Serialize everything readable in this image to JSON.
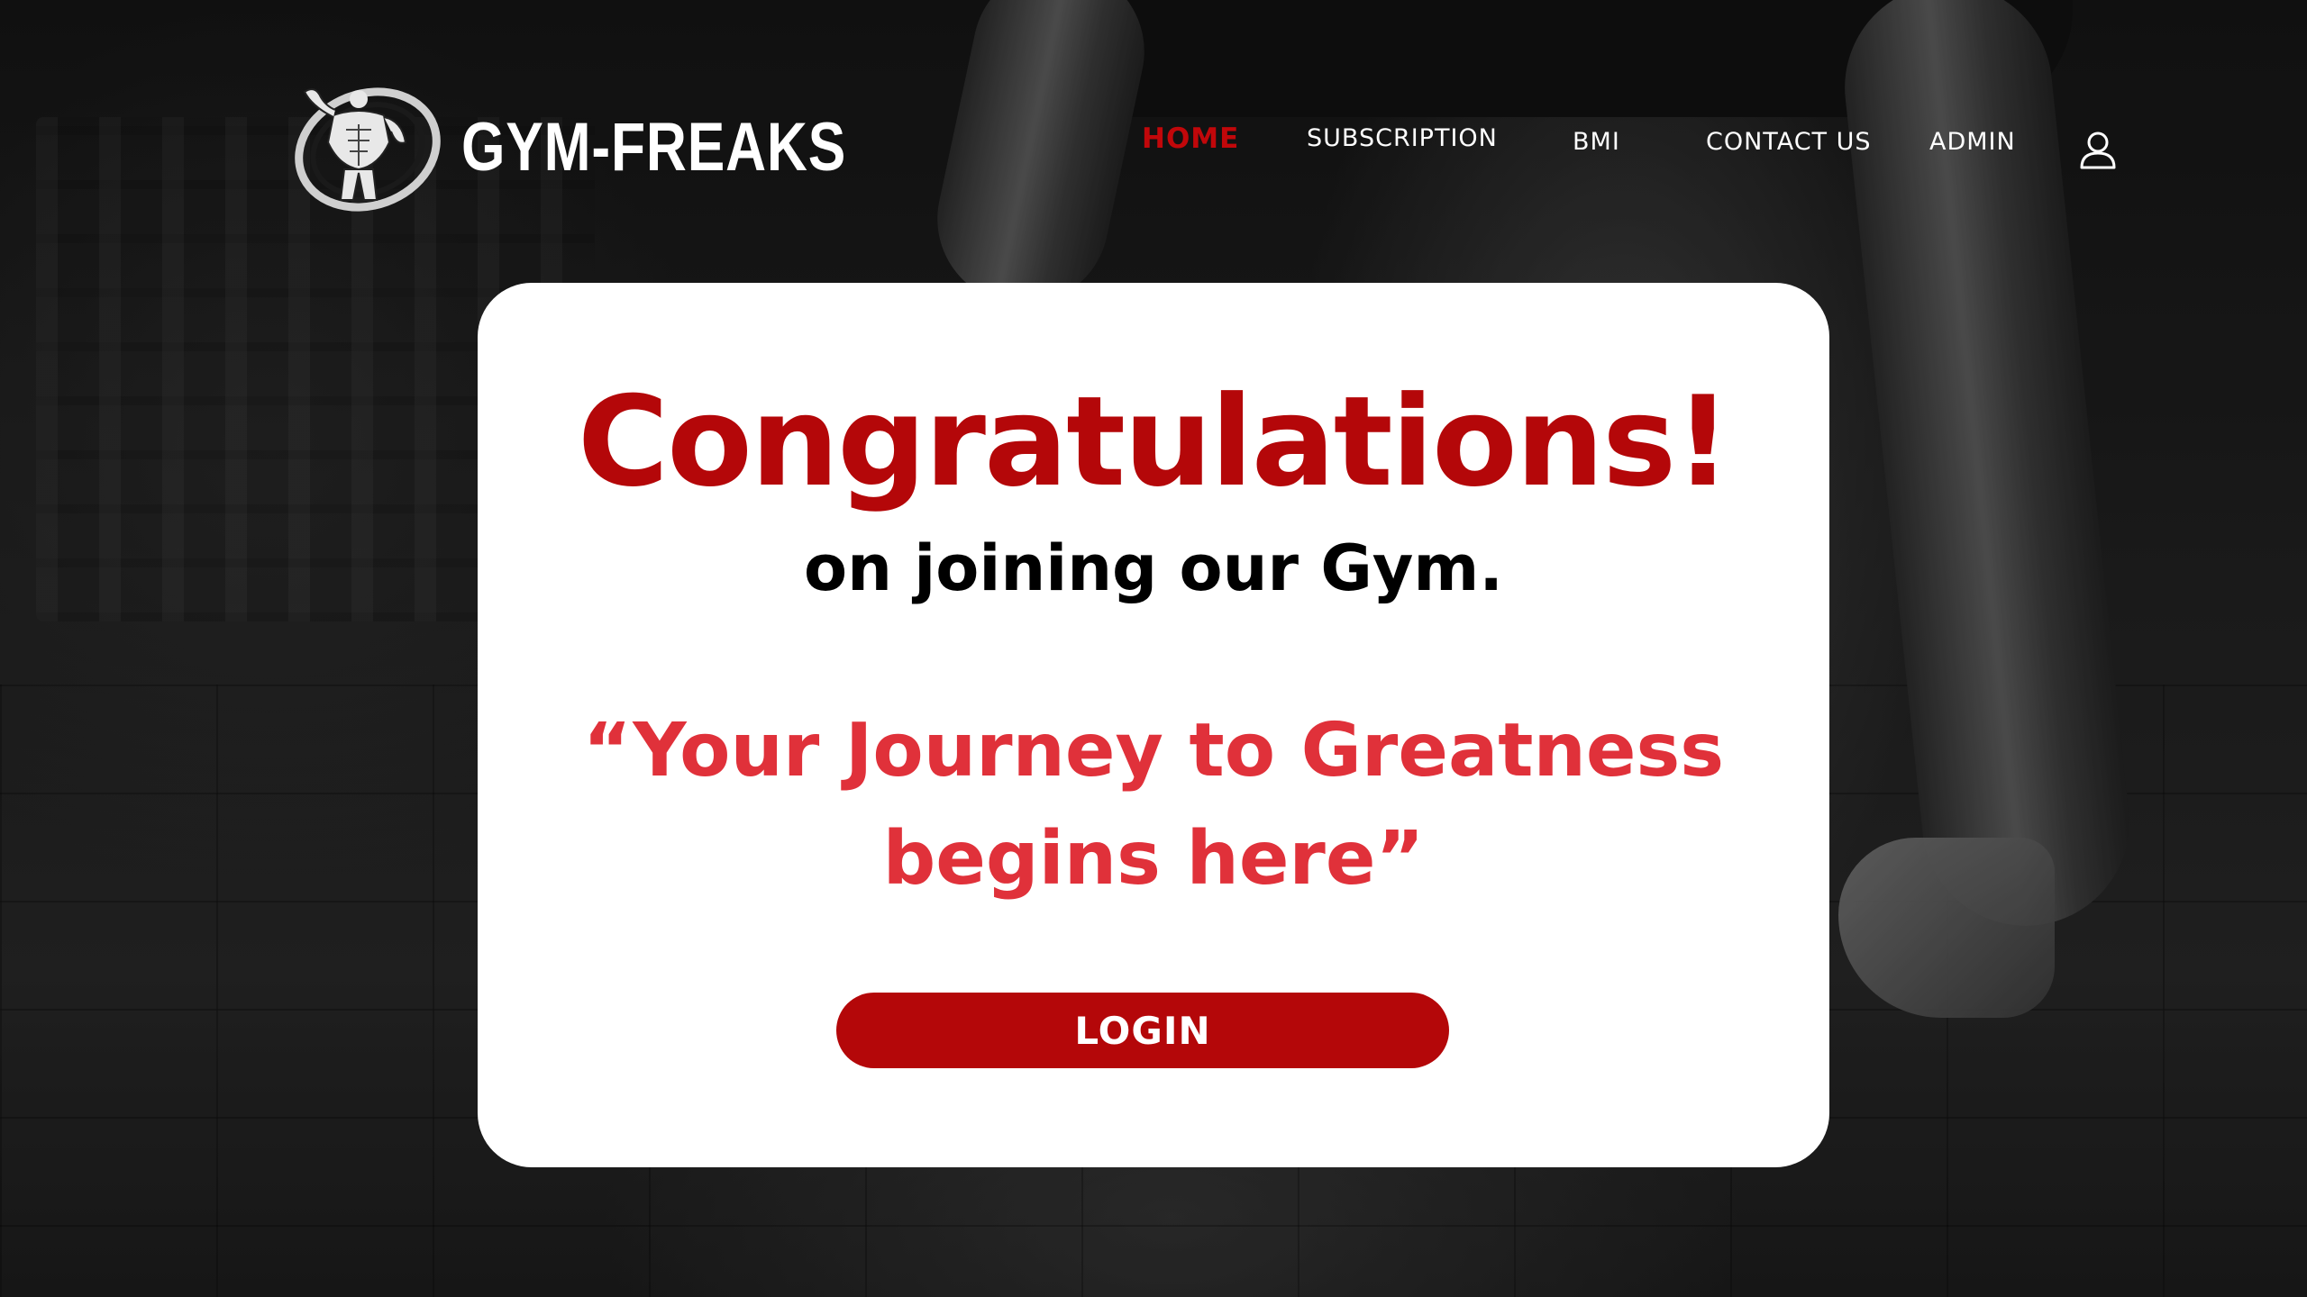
{
  "brand": {
    "name": "GYM-FREAKS",
    "logo_icon": "bodybuilder-logo-icon"
  },
  "nav": {
    "items": [
      {
        "label": "HOME",
        "active": true
      },
      {
        "label": "SUBSCRIPTION",
        "active": false
      },
      {
        "label": "BMI",
        "active": false
      },
      {
        "label": "CONTACT US",
        "active": false
      },
      {
        "label": "ADMIN",
        "active": false
      }
    ],
    "user_icon": "user-icon"
  },
  "card": {
    "heading": "Congratulations!",
    "subheading": "on joining our Gym.",
    "quote_line1": "“Your Journey to Greatness",
    "quote_line2": "begins here”",
    "login_label": "LOGIN"
  },
  "colors": {
    "accent_red": "#b40709",
    "quote_red": "#e0313a",
    "nav_active": "#c1070a",
    "card_bg": "#ffffff",
    "text_dark": "#000000",
    "text_light": "#ffffff"
  }
}
